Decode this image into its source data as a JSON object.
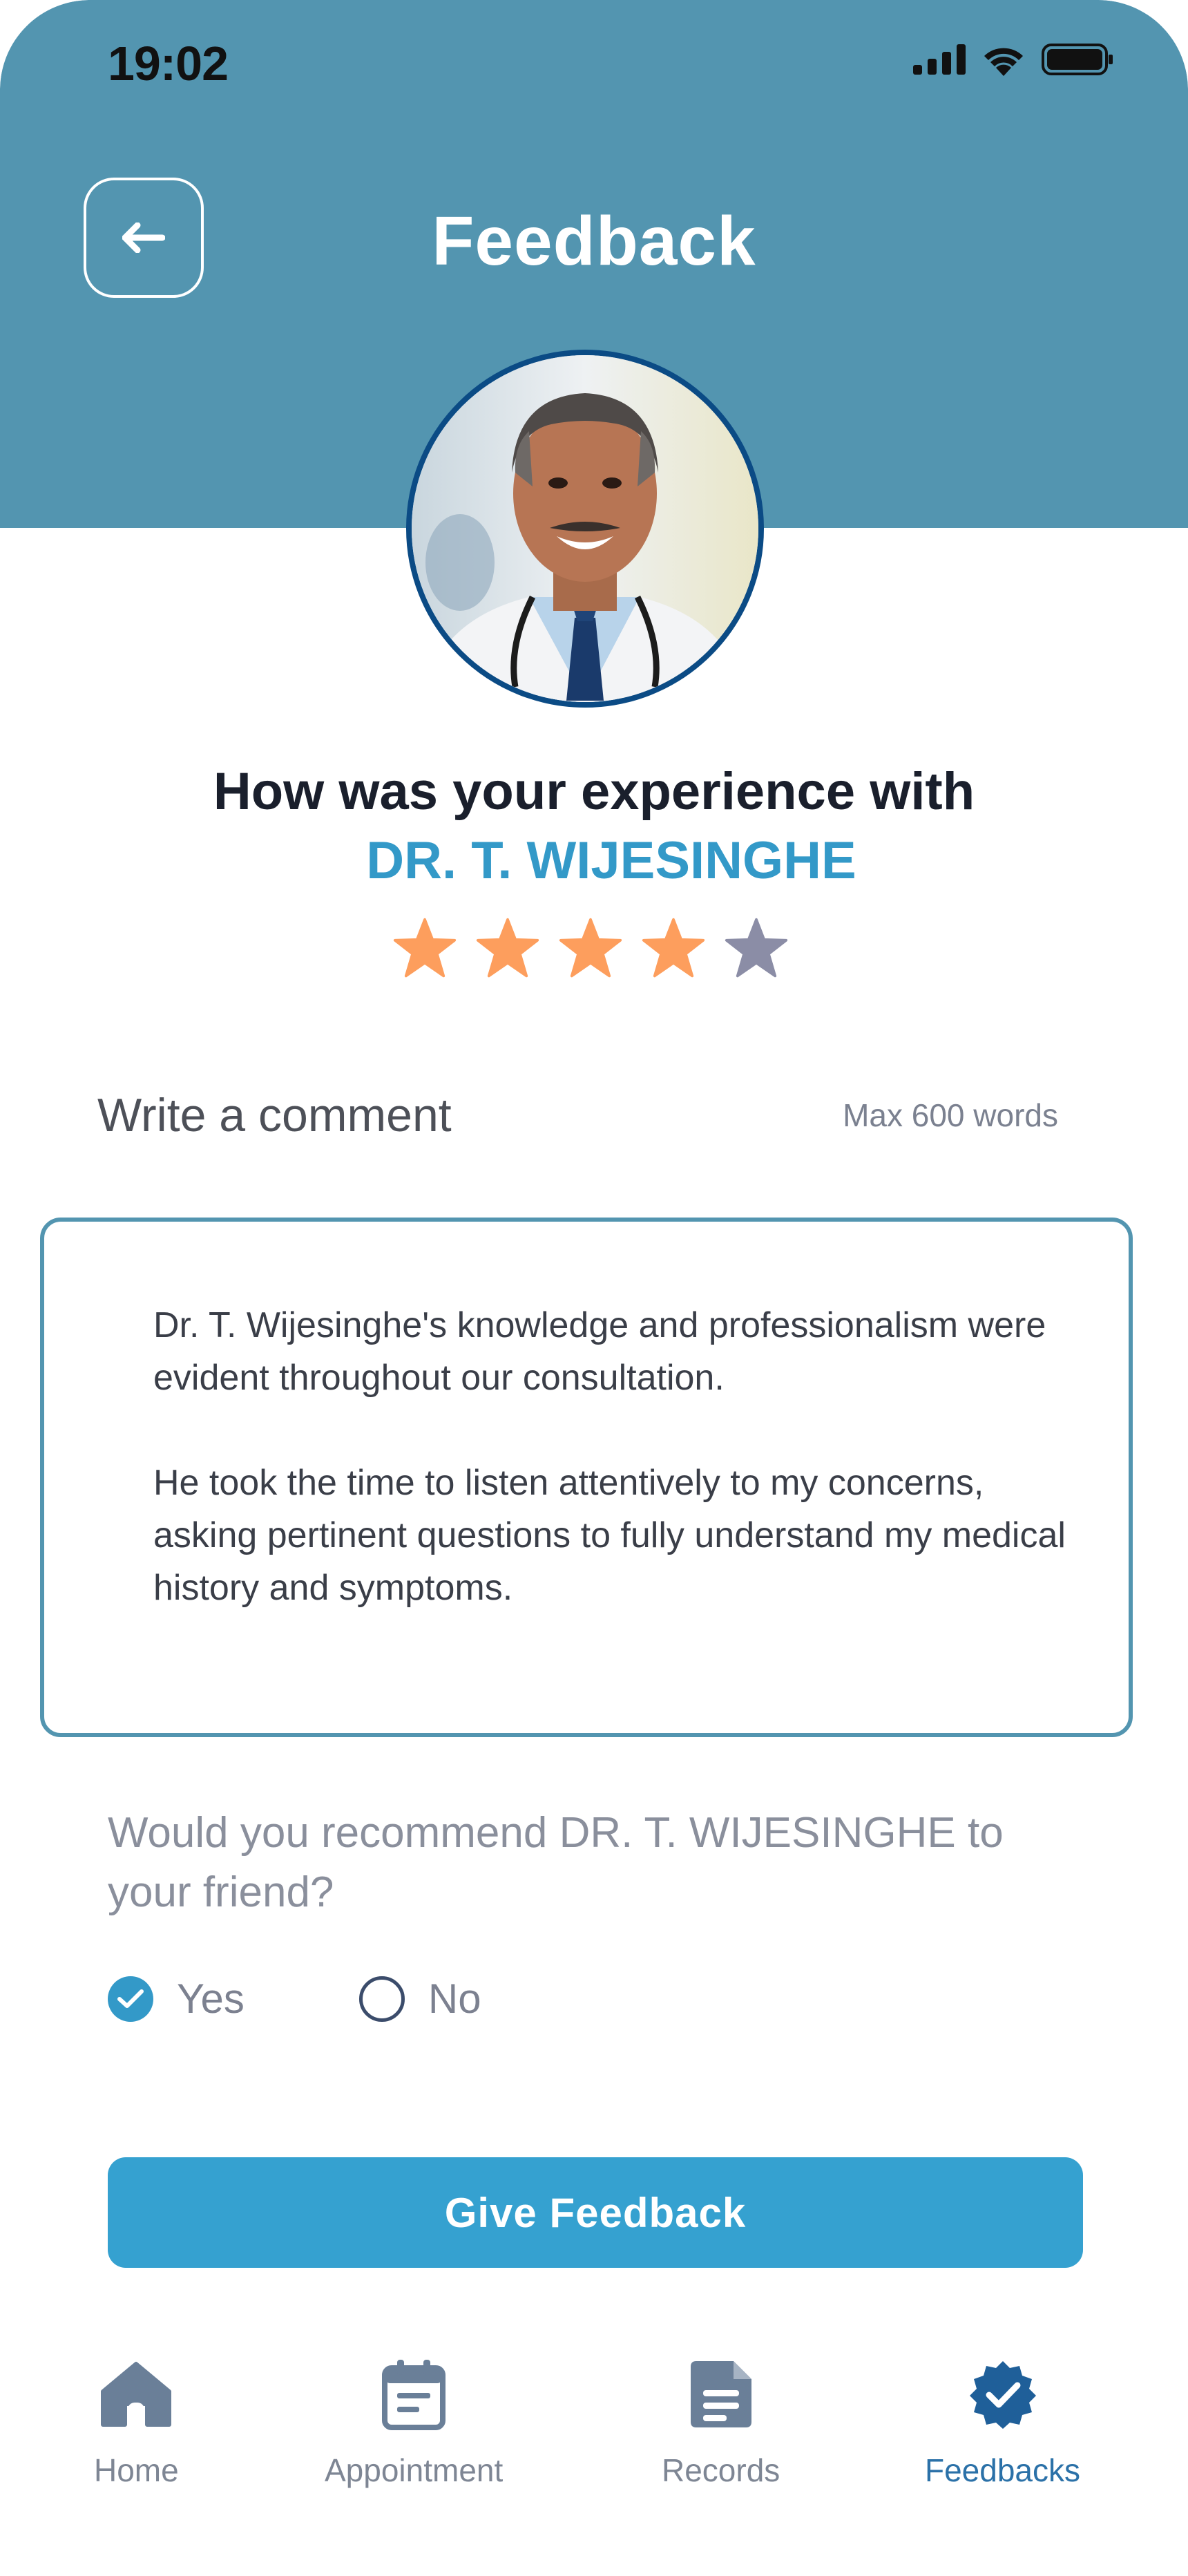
{
  "status_bar": {
    "time": "19:02"
  },
  "header": {
    "title": "Feedback"
  },
  "doctor": {
    "question": "How was your experience with",
    "name": "DR. T. WIJESINGHE"
  },
  "rating": {
    "value": 4,
    "max": 5,
    "filled_color": "#fd9e5d",
    "empty_color": "#8b8da6"
  },
  "comment": {
    "label": "Write a comment",
    "limit": "Max 600 words",
    "paragraph1": "Dr. T. Wijesinghe's knowledge and professionalism were evident throughout our consultation.",
    "paragraph2": "He took the time to listen attentively to my concerns, asking pertinent questions to fully understand my medical history and symptoms."
  },
  "recommend": {
    "question": "Would you recommend DR. T. WIJESINGHE to your friend?",
    "options": [
      {
        "label": "Yes",
        "selected": true
      },
      {
        "label": "No",
        "selected": false
      }
    ]
  },
  "submit": {
    "label": "Give Feedback"
  },
  "nav": {
    "items": [
      {
        "label": "Home",
        "icon": "home-icon",
        "active": false
      },
      {
        "label": "Appointment",
        "icon": "calendar-icon",
        "active": false
      },
      {
        "label": "Records",
        "icon": "document-icon",
        "active": false
      },
      {
        "label": "Feedbacks",
        "icon": "verified-badge-icon",
        "active": true
      }
    ]
  },
  "colors": {
    "header": "#5395b0",
    "accent": "#3399c8",
    "button": "#35a1d0",
    "nav_active": "#2b71a8"
  }
}
